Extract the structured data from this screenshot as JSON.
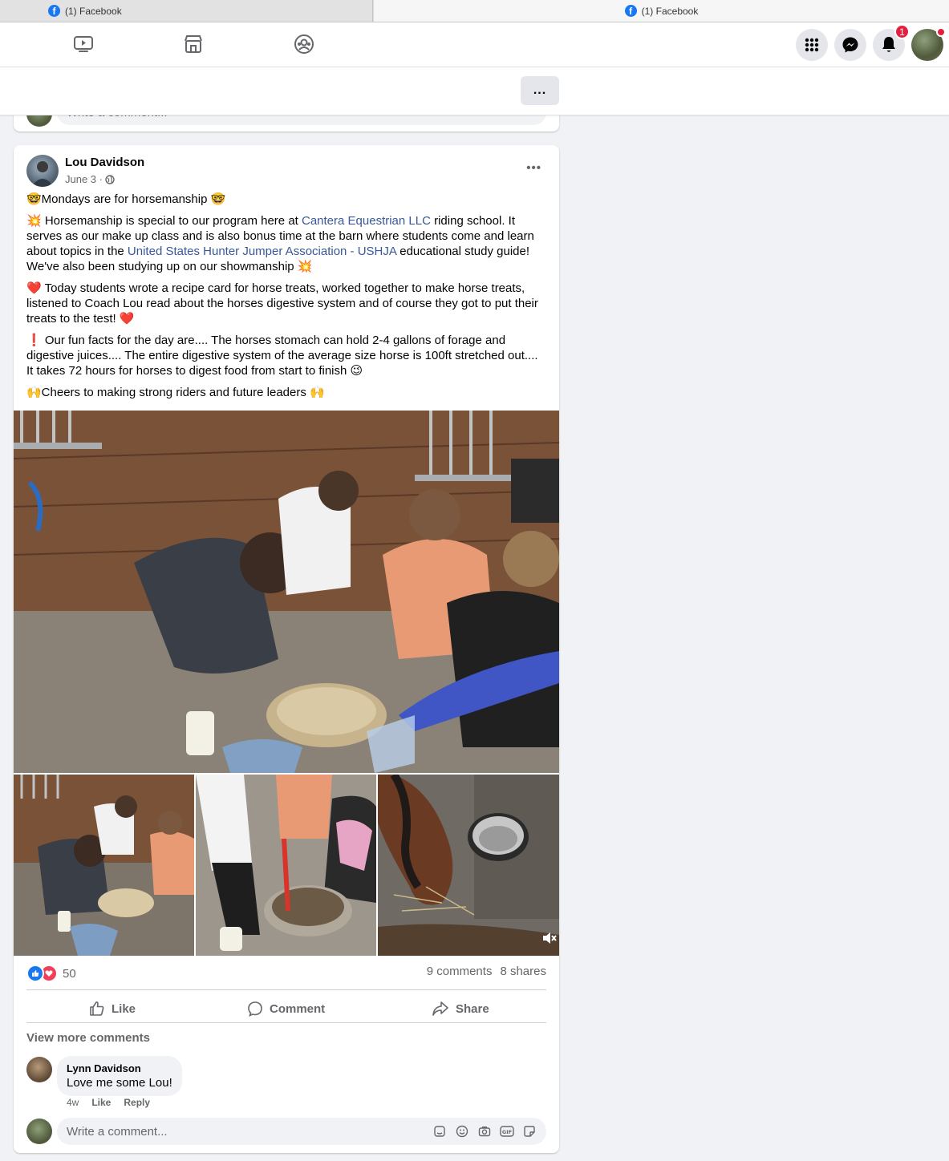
{
  "browser": {
    "tabs": [
      {
        "label": "(1) Facebook",
        "active": false
      },
      {
        "label": "(1) Facebook",
        "active": true
      }
    ]
  },
  "nav": {
    "icons": [
      "watch-icon",
      "marketplace-icon",
      "groups-icon"
    ],
    "notification_count": "1",
    "accent": "#1877f2"
  },
  "subheader": {
    "more_label": "..."
  },
  "post": {
    "author": "Lou Davidson",
    "date": "June 3 ·",
    "visibility_icon": "globe-icon",
    "paragraphs": {
      "p1": "🤓Mondays are for horsemanship 🤓",
      "p2_a": "💥 Horsemanship is special to our program here at ",
      "p2_link1": "Cantera Equestrian LLC",
      "p2_b": " riding school. It serves as our make up class and is also bonus time at the barn where students come and learn about topics in the ",
      "p2_link2": "United States Hunter Jumper Association - USHJA",
      "p2_c": " educational study guide! We've also been studying up on our showmanship 💥",
      "p3": "❤️ Today students wrote a recipe card for horse treats, worked together to make horse treats, listened to Coach Lou read about the horses digestive system and of course they got to put their treats to the test! ❤️",
      "p4": "❗ Our fun facts for the day are.... The horses stomach can hold 2-4 gallons of forage and digestive juices.... The entire digestive system of the average size horse is 100ft stretched out.... It takes 72 hours for horses to digest food from start to finish 😉",
      "p5": "🙌Cheers to making strong riders and future leaders 🙌"
    },
    "reaction_count": "50",
    "comments_count": "9 comments",
    "shares_count": "8 shares",
    "actions": {
      "like": "Like",
      "comment": "Comment",
      "share": "Share"
    },
    "view_more": "View more comments",
    "comment": {
      "name": "Lynn Davidson",
      "text": "Love me some Lou!",
      "time": "4w",
      "like": "Like",
      "reply": "Reply"
    },
    "write_placeholder": "Write a comment...",
    "prev_placeholder": "Write a comment..."
  }
}
